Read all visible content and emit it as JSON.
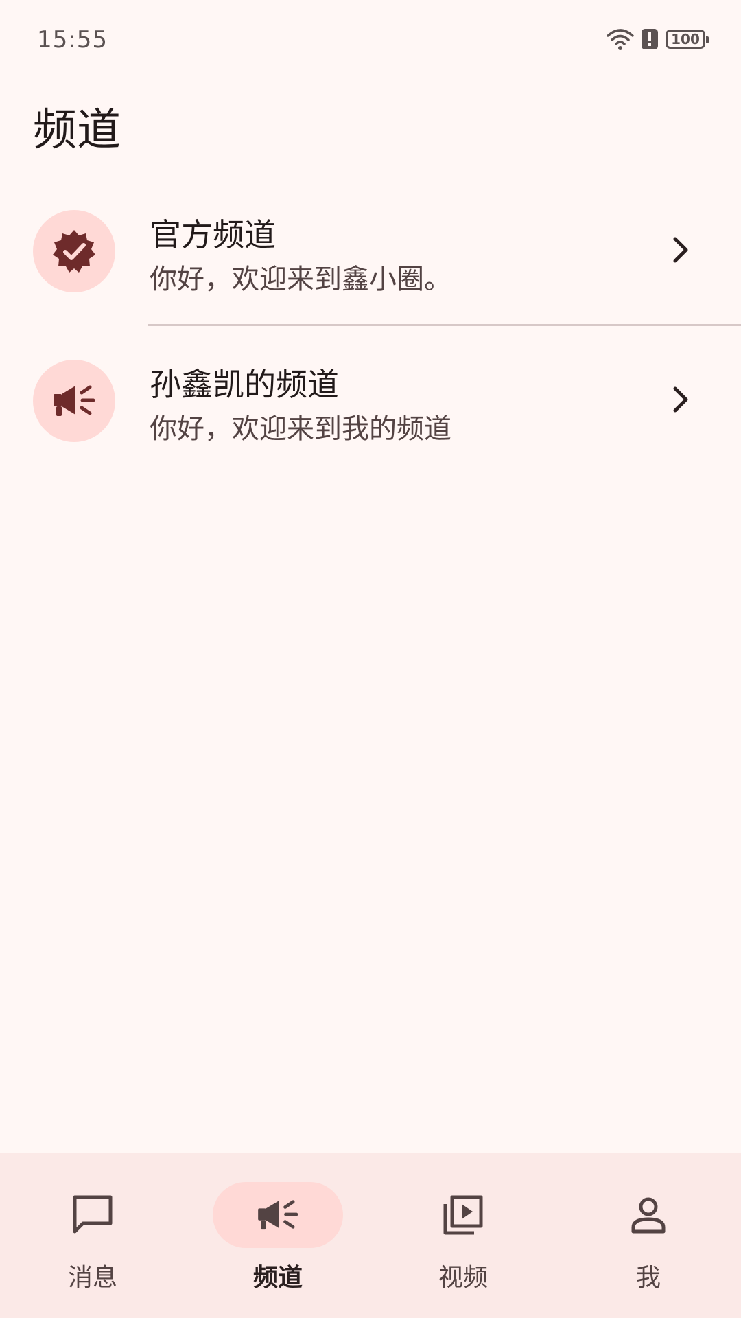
{
  "status_bar": {
    "time": "15:55",
    "battery": "100",
    "icons": [
      "wifi-icon",
      "alert-icon",
      "battery-icon"
    ]
  },
  "page": {
    "title": "频道"
  },
  "channels": [
    {
      "title": "官方频道",
      "subtitle": "你好，欢迎来到鑫小圈。",
      "icon": "verified-badge-icon"
    },
    {
      "title": "孙鑫凯的频道",
      "subtitle": "你好，欢迎来到我的频道",
      "icon": "megaphone-icon"
    }
  ],
  "bottom_nav": {
    "items": [
      {
        "label": "消息",
        "icon": "chat-bubble-icon",
        "active": false
      },
      {
        "label": "频道",
        "icon": "megaphone-icon",
        "active": true
      },
      {
        "label": "视频",
        "icon": "video-library-icon",
        "active": false
      },
      {
        "label": "我",
        "icon": "person-icon",
        "active": false
      }
    ]
  },
  "colors": {
    "background": "#fff7f5",
    "accent_container": "#ffd9d6",
    "icon_dark": "#6e2b2b",
    "nav_background": "#fbe9e7"
  }
}
